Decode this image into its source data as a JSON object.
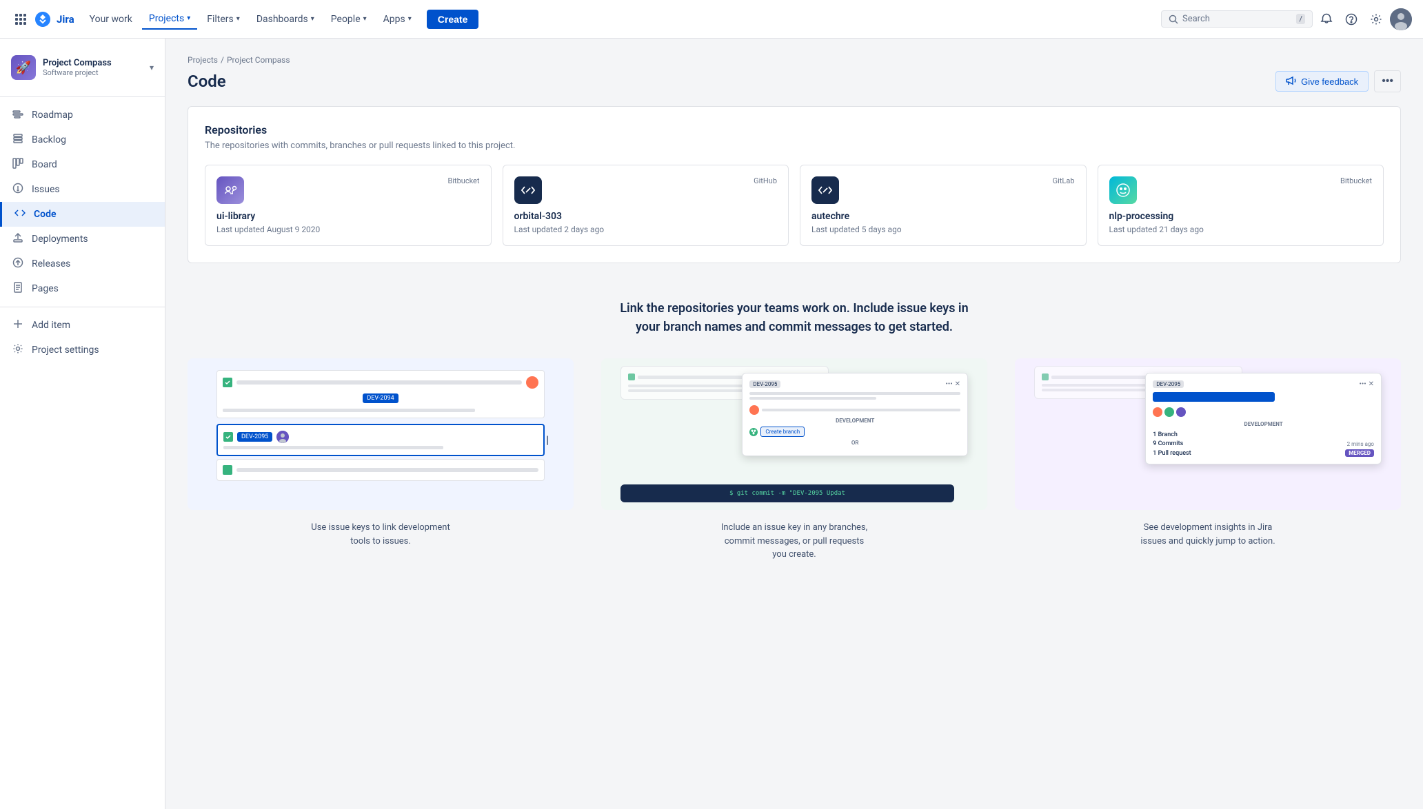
{
  "topnav": {
    "logo_text": "Jira",
    "grid_icon": "⊞",
    "nav_items": [
      {
        "id": "your-work",
        "label": "Your work",
        "active": false,
        "has_dropdown": false
      },
      {
        "id": "projects",
        "label": "Projects",
        "active": true,
        "has_dropdown": true
      },
      {
        "id": "filters",
        "label": "Filters",
        "active": false,
        "has_dropdown": true
      },
      {
        "id": "dashboards",
        "label": "Dashboards",
        "active": false,
        "has_dropdown": true
      },
      {
        "id": "people",
        "label": "People",
        "active": false,
        "has_dropdown": true
      },
      {
        "id": "apps",
        "label": "Apps",
        "active": false,
        "has_dropdown": true
      }
    ],
    "create_label": "Create",
    "search_placeholder": "Search",
    "search_shortcut": "/",
    "notification_icon": "🔔",
    "help_icon": "?",
    "settings_icon": "⚙",
    "avatar_initials": "U"
  },
  "sidebar": {
    "project_name": "Project Compass",
    "project_sub": "Software project",
    "items": [
      {
        "id": "roadmap",
        "label": "Roadmap",
        "icon": "≡"
      },
      {
        "id": "backlog",
        "label": "Backlog",
        "icon": "☰"
      },
      {
        "id": "board",
        "label": "Board",
        "icon": "⊞"
      },
      {
        "id": "issues",
        "label": "Issues",
        "icon": "!"
      },
      {
        "id": "code",
        "label": "Code",
        "icon": "</>",
        "active": true
      },
      {
        "id": "deployments",
        "label": "Deployments",
        "icon": "↑"
      },
      {
        "id": "releases",
        "label": "Releases",
        "icon": "▷"
      },
      {
        "id": "pages",
        "label": "Pages",
        "icon": "📄"
      },
      {
        "id": "add-item",
        "label": "Add item",
        "icon": "+"
      },
      {
        "id": "project-settings",
        "label": "Project settings",
        "icon": "⚙"
      }
    ]
  },
  "breadcrumb": {
    "parts": [
      "Projects",
      "/",
      "Project Compass"
    ]
  },
  "page": {
    "title": "Code",
    "feedback_label": "Give feedback",
    "more_icon": "•••"
  },
  "repositories": {
    "section_title": "Repositories",
    "section_subtitle": "The repositories with commits, branches or pull requests linked to this project.",
    "items": [
      {
        "id": "ui-library",
        "name": "ui-library",
        "source": "Bitbucket",
        "updated": "Last updated August 9 2020",
        "icon_type": "purple"
      },
      {
        "id": "orbital-303",
        "name": "orbital-303",
        "source": "GitHub",
        "updated": "Last updated 2 days ago",
        "icon_type": "dark"
      },
      {
        "id": "autechre",
        "name": "autechre",
        "source": "GitLab",
        "updated": "Last updated 5 days ago",
        "icon_type": "dark"
      },
      {
        "id": "nlp-processing",
        "name": "nlp-processing",
        "source": "Bitbucket",
        "updated": "Last updated 21 days ago",
        "icon_type": "teal"
      }
    ]
  },
  "promo": {
    "title": "Link the repositories your teams work on. Include issue keys in\nyour branch names and commit messages to get started.",
    "cards": [
      {
        "id": "link-issues",
        "caption": "Use issue keys to link development\ntools to issues."
      },
      {
        "id": "include-key",
        "caption": "Include an issue key in any branches,\ncommit messages, or pull requests\nyou create."
      },
      {
        "id": "dev-insights",
        "caption": "See development insights in Jira\nissues and quickly jump to action."
      }
    ]
  },
  "mock": {
    "dev_id_1": "DEV-2094",
    "dev_id_2": "DEV-2095",
    "dev_id_3": "DEV-2095",
    "commit_text": "$ git commit -m \"DEV-2095 Updat",
    "create_branch": "Create branch",
    "development_label": "DEVELOPMENT",
    "branch_count": "1 Branch",
    "commits_count": "9 Commits",
    "commits_time": "2 mins ago",
    "pr_count": "1 Pull request",
    "merged_label": "MERGED",
    "dev_label_2": "DEVELOPMENT"
  }
}
